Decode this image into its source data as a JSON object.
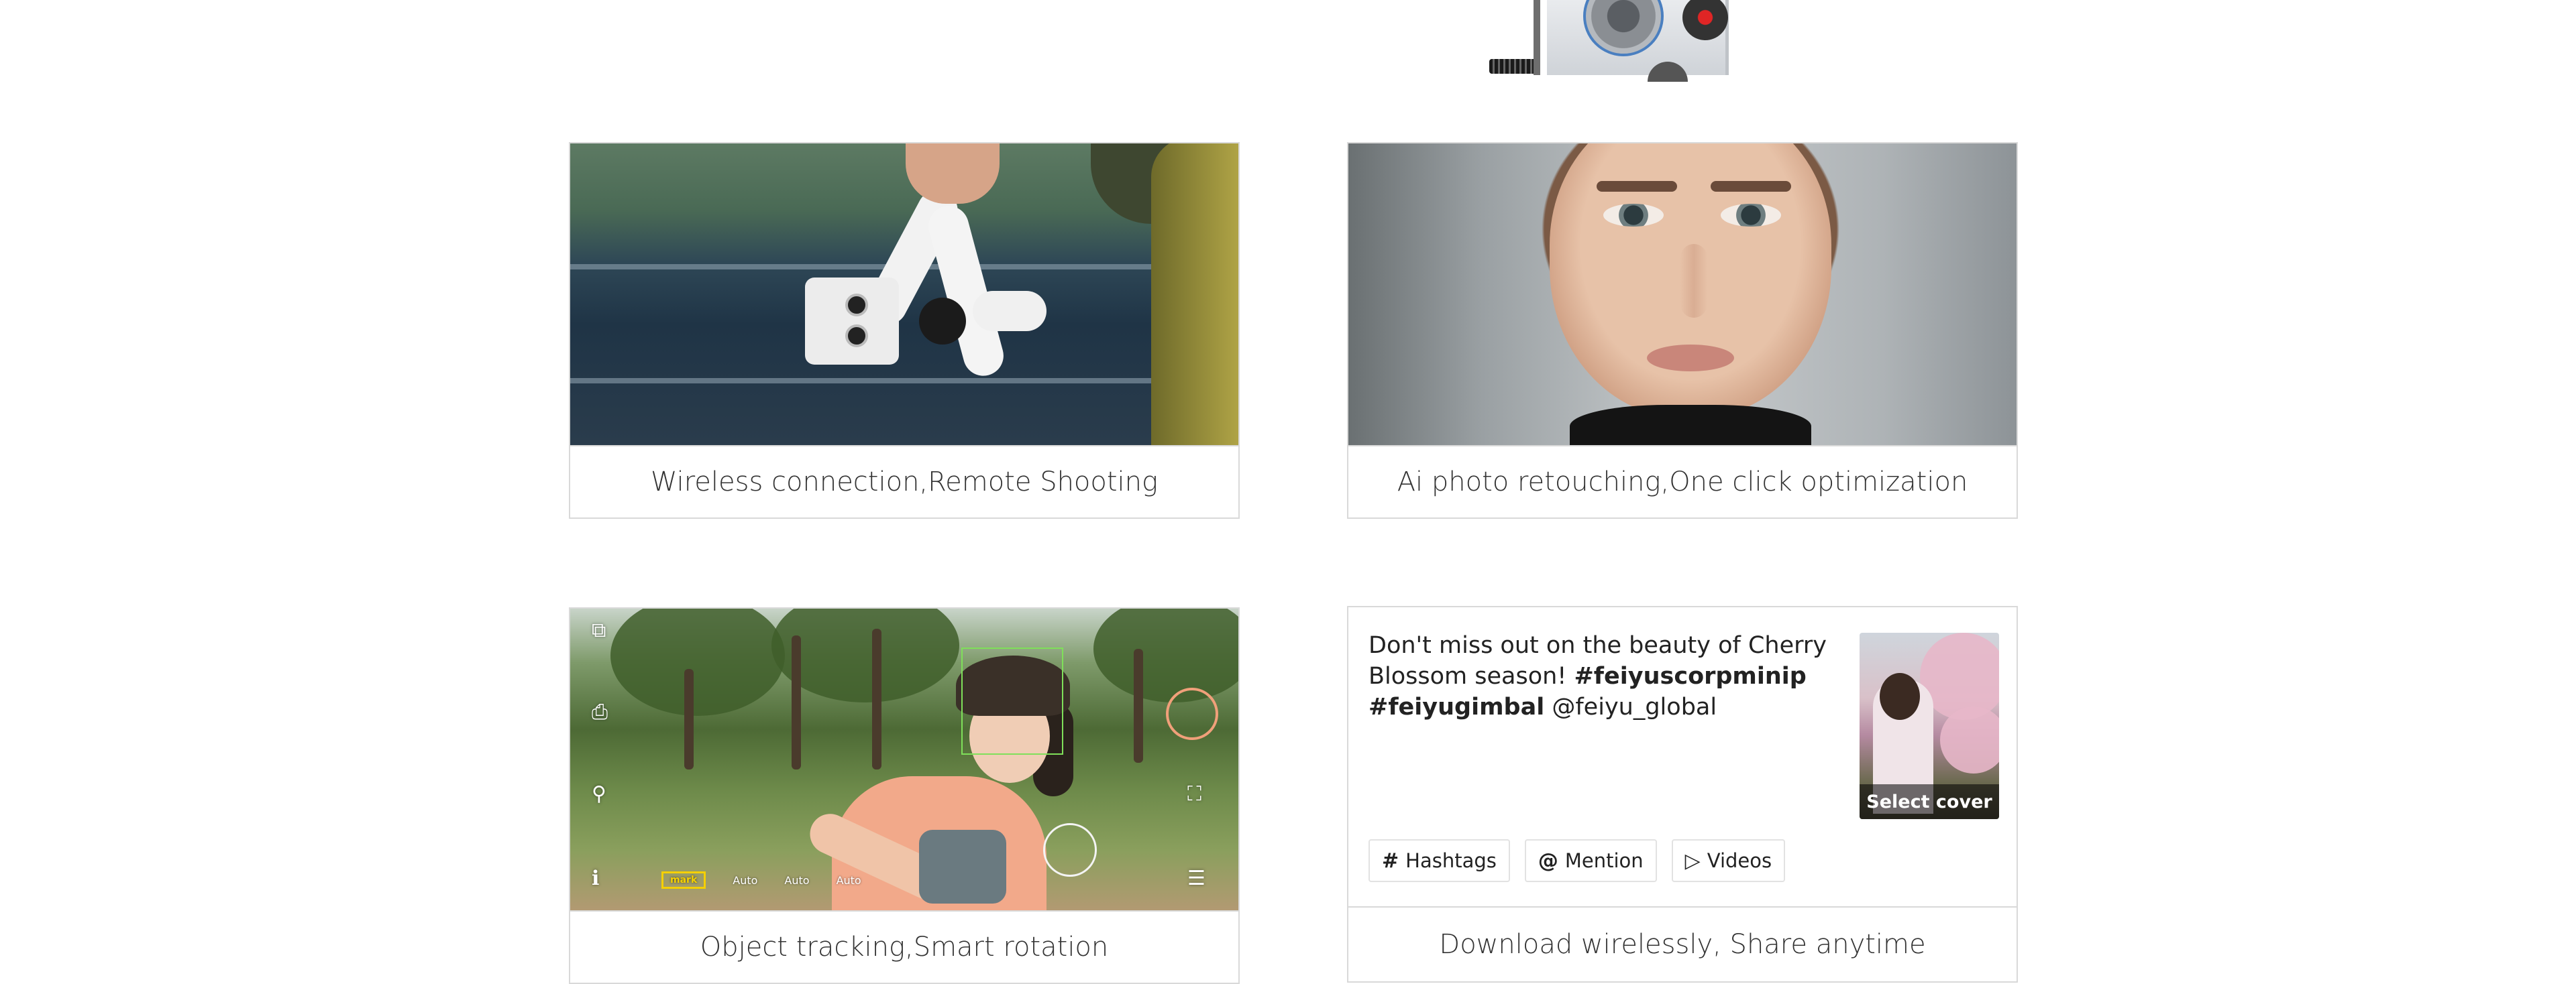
{
  "cards": [
    {
      "caption": "Wireless connection,Remote Shooting"
    },
    {
      "caption": "Ai photo retouching,One click optimization"
    },
    {
      "caption": "Object tracking,Smart rotation"
    },
    {
      "caption": "Download wirelessly, Share anytime"
    }
  ],
  "tracking_ui": {
    "status": [
      "Auto",
      "Auto",
      "Auto"
    ],
    "mode_badge": "mark"
  },
  "share": {
    "text_plain": "Don't miss out on the beauty of Cherry Blossom season! ",
    "tag1": "#feiyuscorpminip",
    "tag2": "#feiyugimbal",
    "mention": "@feiyu_global",
    "cover_label": "Select cover",
    "chips": [
      {
        "icon": "#",
        "label": "Hashtags"
      },
      {
        "icon": "@",
        "label": "Mention"
      },
      {
        "icon": "▷",
        "label": "Videos"
      }
    ]
  },
  "icons": {
    "hashtag": "hashtag-icon",
    "mention": "at-icon",
    "videos": "play-circle-icon"
  }
}
